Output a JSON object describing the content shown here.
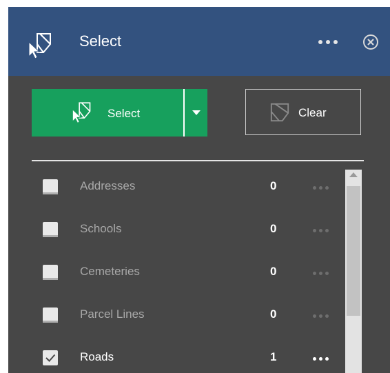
{
  "header": {
    "icon": "select-cursor-icon",
    "title": "Select",
    "more_icon": "ellipsis-icon",
    "close_icon": "close-icon",
    "bg_color": "#33527f"
  },
  "toolbar": {
    "select_label": "Select",
    "select_icon": "select-cursor-icon",
    "dropdown_icon": "caret-down-icon",
    "clear_label": "Clear",
    "clear_icon": "clear-selection-icon",
    "accent_color": "#17a05d"
  },
  "layers": [
    {
      "label": "Addresses",
      "count": "0",
      "checked": false
    },
    {
      "label": "Schools",
      "count": "0",
      "checked": false
    },
    {
      "label": "Cemeteries",
      "count": "0",
      "checked": false
    },
    {
      "label": "Parcel Lines",
      "count": "0",
      "checked": false
    },
    {
      "label": "Roads",
      "count": "1",
      "checked": true
    }
  ]
}
